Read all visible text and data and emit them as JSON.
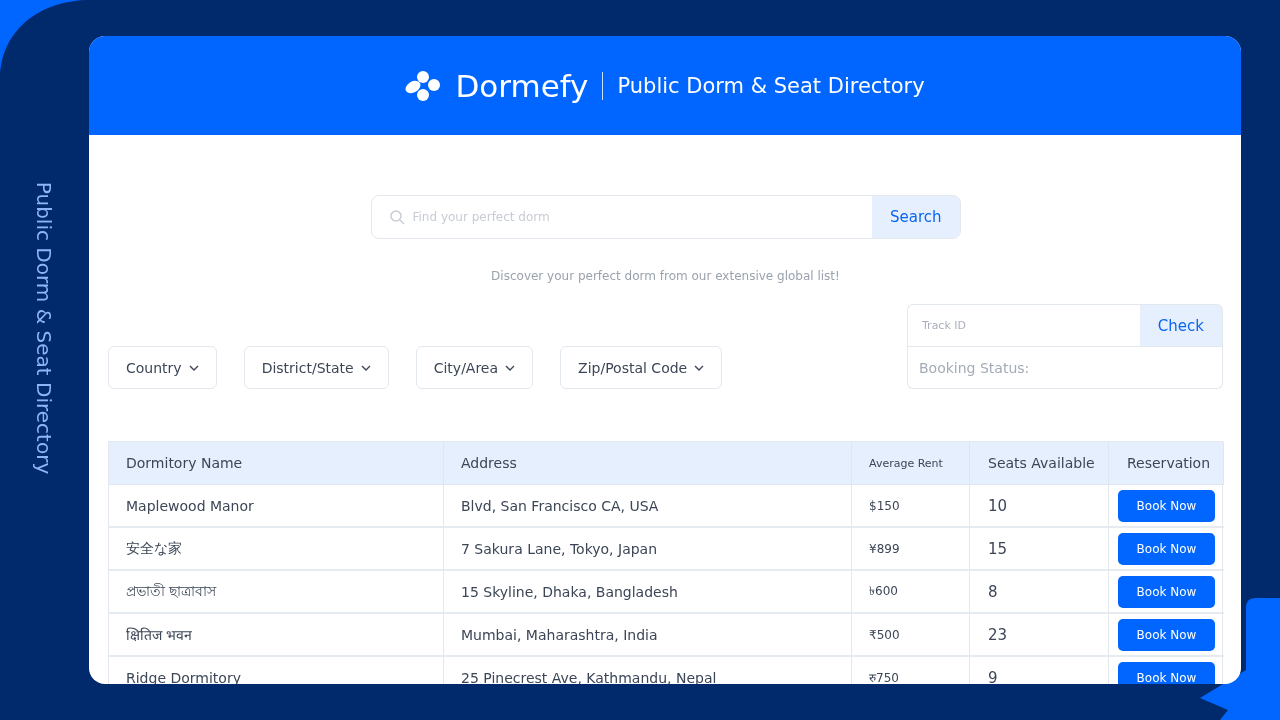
{
  "side_title": "Public Dorm & Seat Directory",
  "header": {
    "brand": "Dormefy",
    "title": "Public Dorm & Seat Directory"
  },
  "search": {
    "placeholder": "Find your perfect dorm",
    "button": "Search",
    "caption": "Discover your perfect dorm from our extensive global list!"
  },
  "filters": [
    {
      "label": "Country"
    },
    {
      "label": "District/State"
    },
    {
      "label": "City/Area"
    },
    {
      "label": "Zip/Postal Code"
    }
  ],
  "tracker": {
    "placeholder": "Track ID",
    "button": "Check",
    "status_label": "Booking Status:"
  },
  "table": {
    "columns": [
      "Dormitory Name",
      "Address",
      "Average Rent",
      "Seats Available",
      "Reservation"
    ],
    "rows": [
      {
        "name": "Maplewood Manor",
        "address": "Blvd, San Francisco CA, USA",
        "rent": "$150",
        "seats": "10",
        "action": "Book Now"
      },
      {
        "name": "安全な家",
        "address": "7 Sakura Lane, Tokyo, Japan",
        "rent": "¥899",
        "seats": "15",
        "action": "Book Now"
      },
      {
        "name": "প্রভাতী ছাত্রাবাস",
        "address": "15 Skyline, Dhaka, Bangladesh",
        "rent": "৳600",
        "seats": "8",
        "action": "Book Now"
      },
      {
        "name": "क्षितिज भवन",
        "address": "Mumbai, Maharashtra, India",
        "rent": "₹500",
        "seats": "23",
        "action": "Book Now"
      },
      {
        "name": "Ridge Dormitory",
        "address": "25 Pinecrest Ave, Kathmandu, Nepal",
        "rent": "रु750",
        "seats": "9",
        "action": "Book Now"
      }
    ]
  }
}
